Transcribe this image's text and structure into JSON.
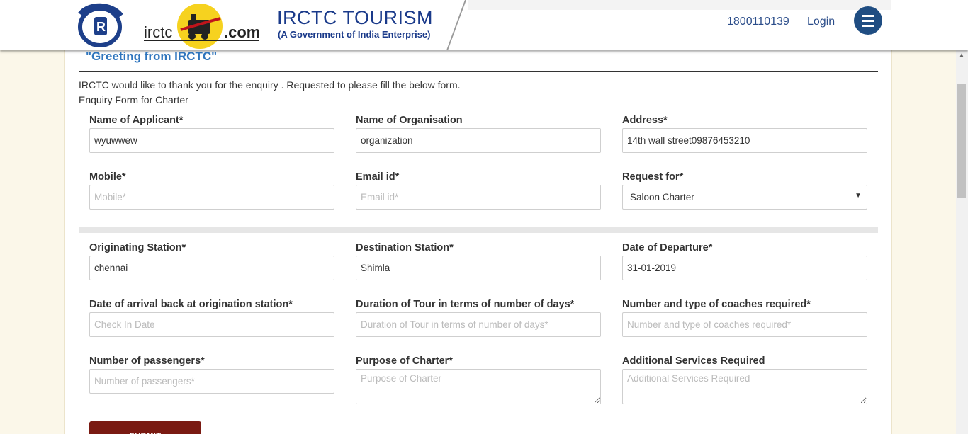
{
  "header": {
    "brand_left": "irctc",
    "brand_right": ".com",
    "title": "IRCTC TOURISM",
    "subtitle": "(A Government of India Enterprise)",
    "phone": "1800110139",
    "login_label": "Login",
    "menu_icon": "hamburger-menu-icon",
    "accent_color": "#1a3a8a"
  },
  "page": {
    "greeting": "\"Greeting from IRCTC\"",
    "intro": "IRCTC would like to thank you for the enquiry . Requested to please fill the below form.",
    "form_title": "Enquiry Form for Charter"
  },
  "form": {
    "applicant": {
      "label": "Name of Applicant*",
      "value": "wyuwwew",
      "placeholder": "Name of Applicant*"
    },
    "organisation": {
      "label": "Name of Organisation",
      "value": "organization",
      "placeholder": "Name of Organisation"
    },
    "address": {
      "label": "Address*",
      "value": "14th wall street09876453210",
      "placeholder": "Address*"
    },
    "mobile": {
      "label": "Mobile*",
      "value": "",
      "placeholder": "Mobile*"
    },
    "email": {
      "label": "Email id*",
      "value": "",
      "placeholder": "Email id*"
    },
    "request_for": {
      "label": "Request for*",
      "selected": "Saloon Charter"
    },
    "origin": {
      "label": "Originating Station*",
      "value": "chennai",
      "placeholder": "Originating Station*"
    },
    "destination": {
      "label": "Destination Station*",
      "value": "Shimla",
      "placeholder": "Destination Station*"
    },
    "departure": {
      "label": "Date of Departure*",
      "value": "31-01-2019",
      "placeholder": "Date of Departure*"
    },
    "arrival": {
      "label": "Date of arrival back at origination station*",
      "value": "",
      "placeholder": "Check In Date"
    },
    "duration": {
      "label": "Duration of Tour in terms of number of days*",
      "value": "",
      "placeholder": "Duration of Tour in terms of number of days*"
    },
    "coaches": {
      "label": "Number and type of coaches required*",
      "value": "",
      "placeholder": "Number and type of coaches required*"
    },
    "passengers": {
      "label": "Number of passengers*",
      "value": "",
      "placeholder": "Number of passengers*"
    },
    "purpose": {
      "label": "Purpose of Charter*",
      "value": "",
      "placeholder": "Purpose of Charter"
    },
    "additional": {
      "label": "Additional Services Required",
      "value": "",
      "placeholder": "Additional Services Required"
    },
    "submit_label": "SUBMIT",
    "submit_color": "#7a1a12"
  }
}
